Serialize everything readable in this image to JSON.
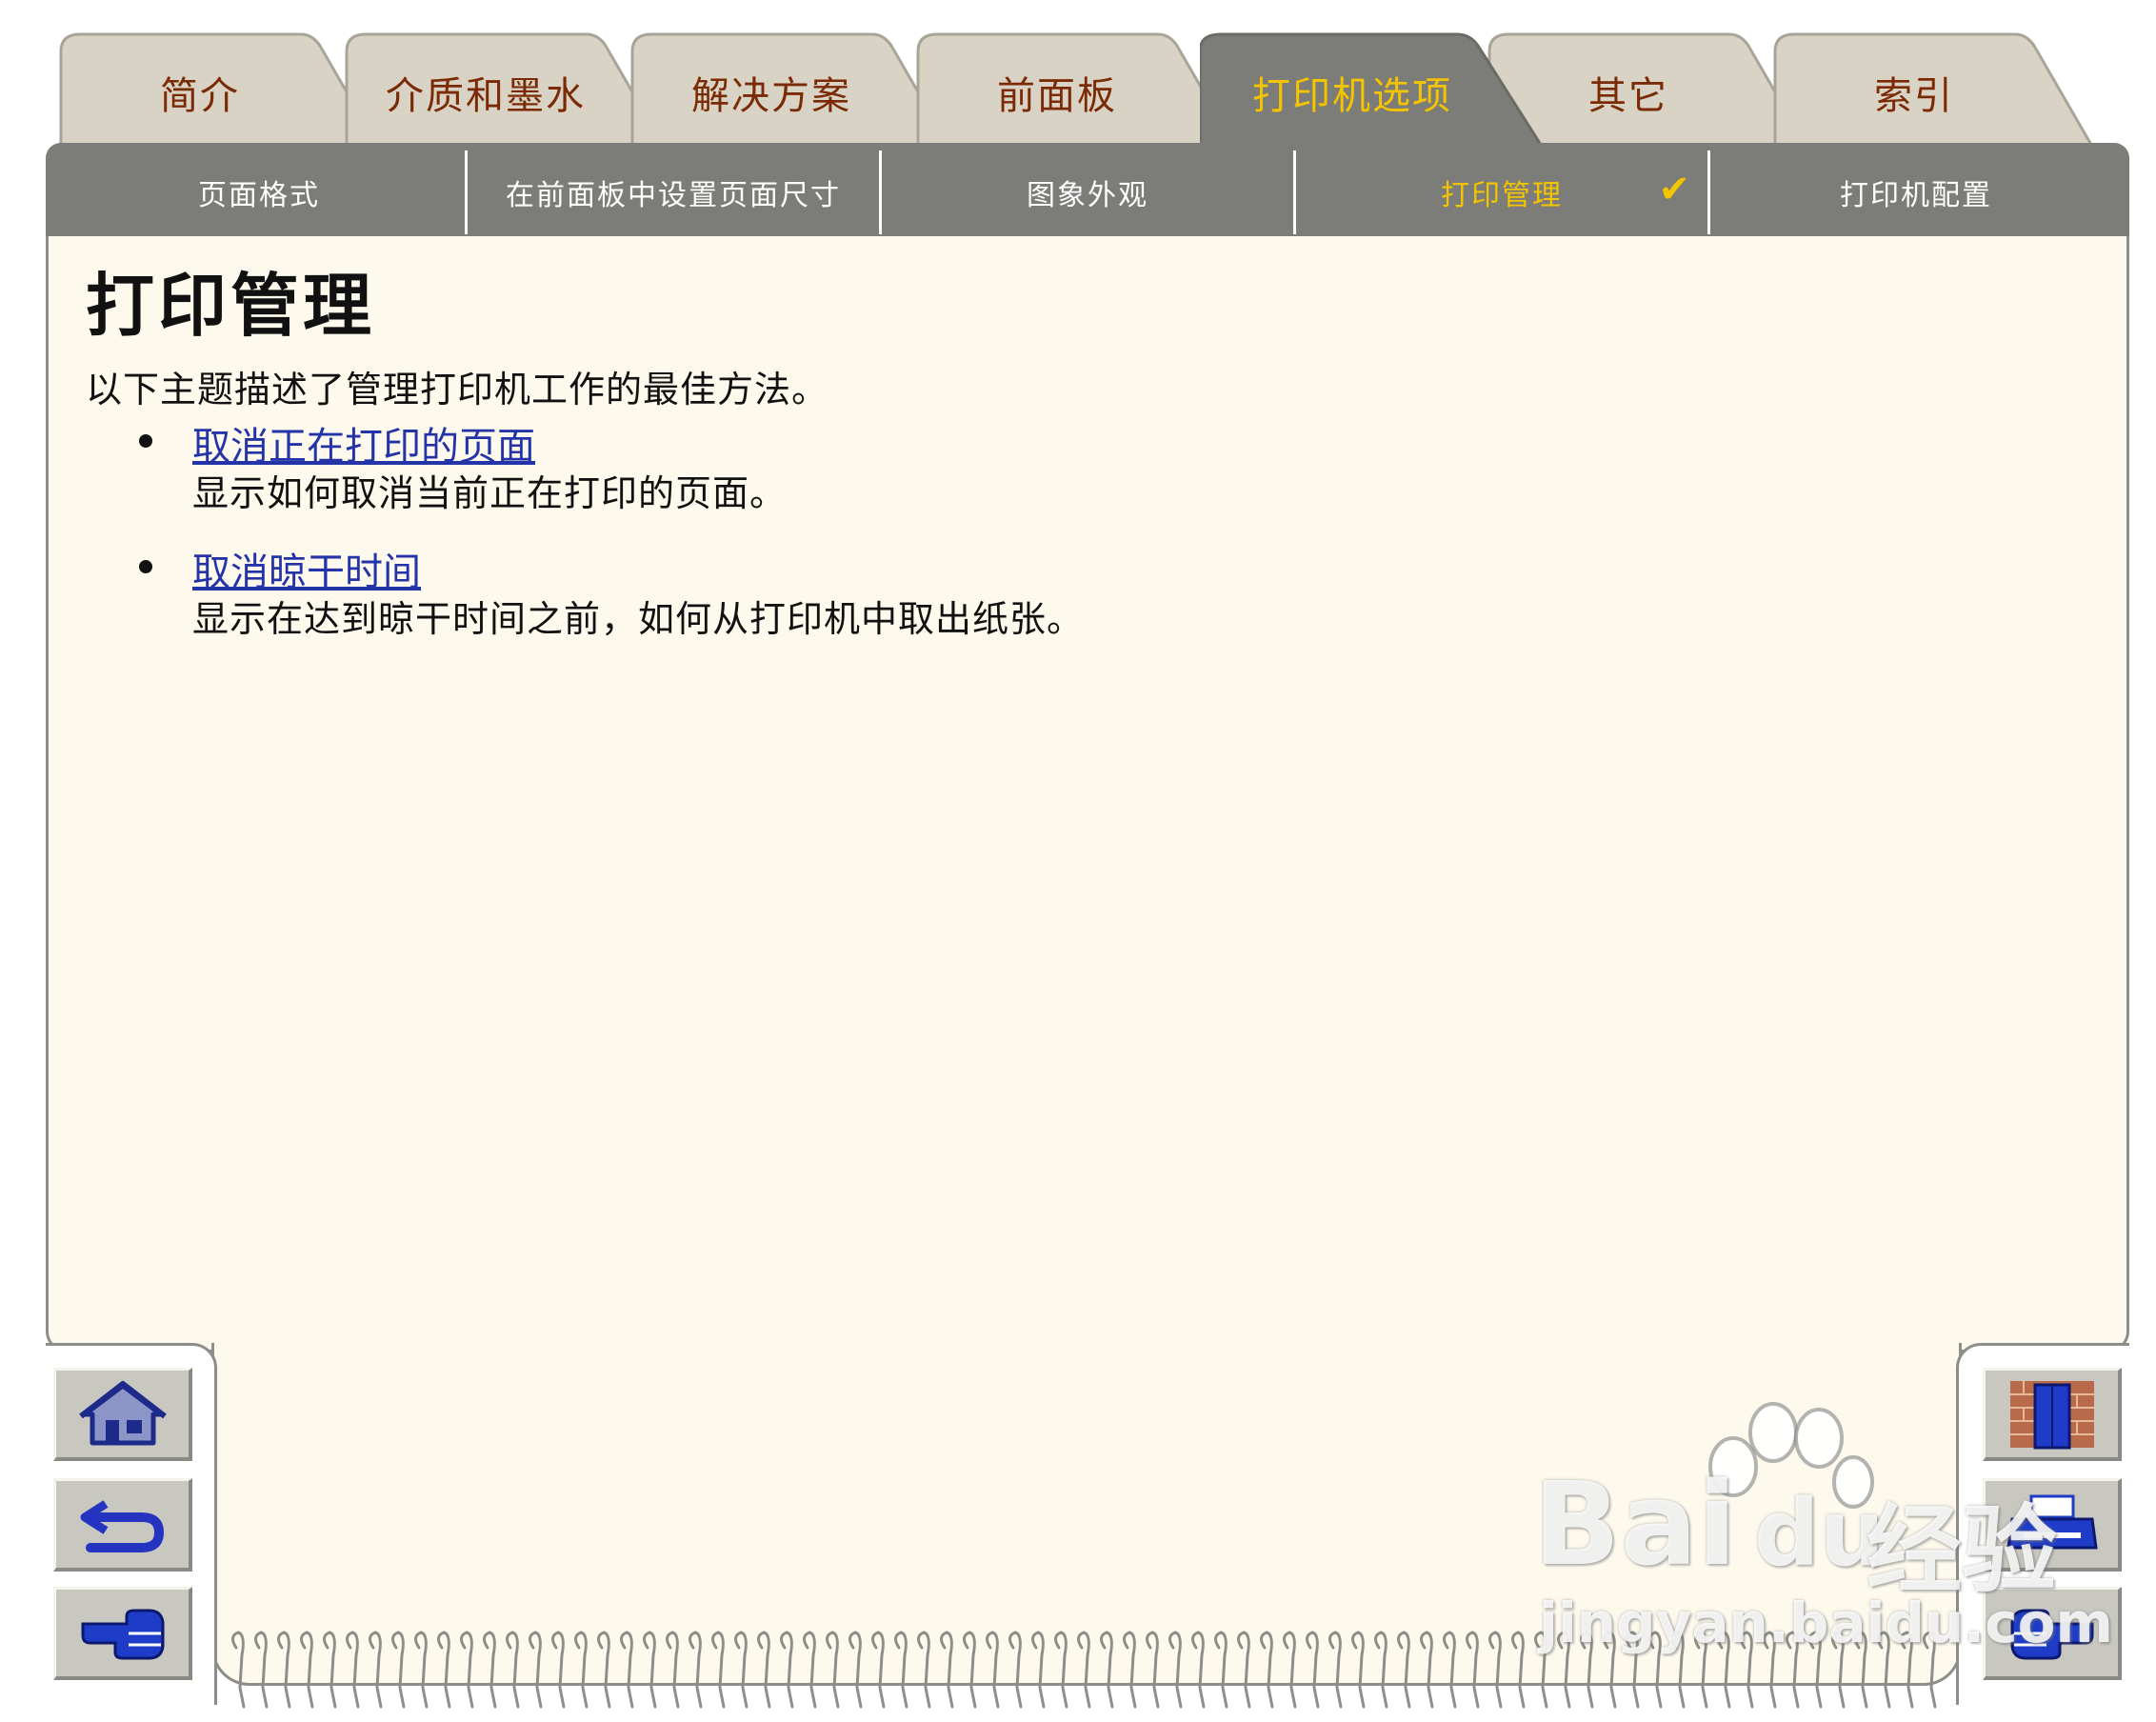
{
  "main_tabs": [
    {
      "label": "简介",
      "active": false
    },
    {
      "label": "介质和墨水",
      "active": false
    },
    {
      "label": "解决方案",
      "active": false
    },
    {
      "label": "前面板",
      "active": false
    },
    {
      "label": "打印机选项",
      "active": true
    },
    {
      "label": "其它",
      "active": false
    },
    {
      "label": "索引",
      "active": false
    }
  ],
  "sub_tabs": [
    {
      "label": "页面格式",
      "active": false
    },
    {
      "label": "在前面板中设置页面尺寸",
      "active": false
    },
    {
      "label": "图象外观",
      "active": false
    },
    {
      "label": "打印管理",
      "active": true
    },
    {
      "label": "打印机配置",
      "active": false
    }
  ],
  "content": {
    "title": "打印管理",
    "intro": "以下主题描述了管理打印机工作的最佳方法。",
    "topics": [
      {
        "link": "取消正在打印的页面",
        "description": "显示如何取消当前正在打印的页面。"
      },
      {
        "link": "取消晾干时间",
        "description": "显示在达到晾干时间之前，如何从打印机中取出纸张。"
      }
    ]
  },
  "watermark": {
    "brand": "Bai",
    "brand2": "du",
    "cn": "经验",
    "url": "jingyan.baidu.com"
  },
  "icons": {
    "home": "home-icon",
    "back": "back-arrow-icon",
    "next": "pointing-hand-icon",
    "exit": "door-icon",
    "print": "printer-icon",
    "forward": "pointing-hand-icon"
  },
  "colors": {
    "active_tab_text": "#f4c400",
    "tab_text": "#7a2a05",
    "link": "#2434a8",
    "paper": "#fdf9ed",
    "subtab_bar": "#7c7c78"
  }
}
